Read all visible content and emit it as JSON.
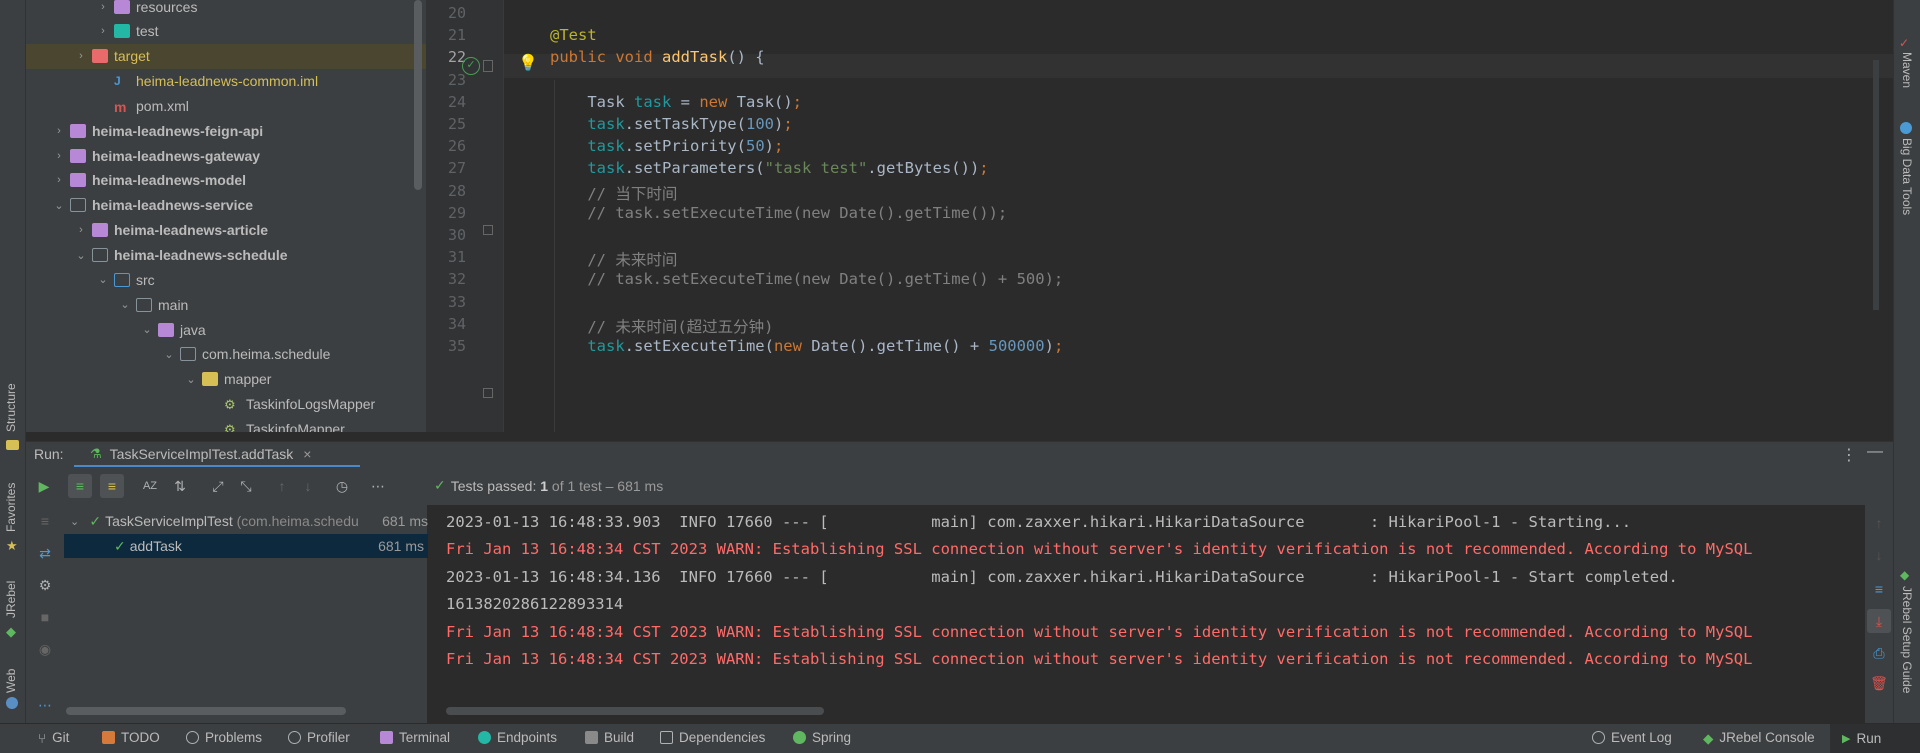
{
  "left_strip": {
    "structure": "Structure",
    "favorites": "Favorites",
    "jrebel": "JRebel",
    "web": "Web"
  },
  "right_strip": {
    "maven": "Maven",
    "bigdata": "Big Data Tools",
    "jrebel_setup": "JRebel Setup Guide"
  },
  "project_tree": [
    {
      "label": "resources",
      "indent": 3,
      "arrow": "›",
      "icon": "folder-mod"
    },
    {
      "label": "test",
      "indent": 3,
      "arrow": "›",
      "icon": "folder-teal"
    },
    {
      "label": "target",
      "indent": 2,
      "arrow": "›",
      "icon": "folder-target",
      "selected": true,
      "color": "#d6bf55"
    },
    {
      "label": "heima-leadnews-common.iml",
      "indent": 3,
      "arrow": "",
      "icon": "iml",
      "color": "#d6bf55"
    },
    {
      "label": "pom.xml",
      "indent": 3,
      "arrow": "",
      "icon": "maven"
    },
    {
      "label": "heima-leadnews-feign-api",
      "indent": 1,
      "arrow": "›",
      "icon": "folder-mod",
      "bold": true
    },
    {
      "label": "heima-leadnews-gateway",
      "indent": 1,
      "arrow": "›",
      "icon": "folder-mod",
      "bold": true
    },
    {
      "label": "heima-leadnews-model",
      "indent": 1,
      "arrow": "›",
      "icon": "folder-mod",
      "bold": true
    },
    {
      "label": "heima-leadnews-service",
      "indent": 1,
      "arrow": "⌄",
      "icon": "folder-outline",
      "bold": true
    },
    {
      "label": "heima-leadnews-article",
      "indent": 2,
      "arrow": "›",
      "icon": "folder-mod",
      "bold": true
    },
    {
      "label": "heima-leadnews-schedule",
      "indent": 2,
      "arrow": "⌄",
      "icon": "folder-outline",
      "bold": true
    },
    {
      "label": "src",
      "indent": 3,
      "arrow": "⌄",
      "icon": "folder-src"
    },
    {
      "label": "main",
      "indent": 4,
      "arrow": "⌄",
      "icon": "folder-outline"
    },
    {
      "label": "java",
      "indent": 5,
      "arrow": "⌄",
      "icon": "folder-mod"
    },
    {
      "label": "com.heima.schedule",
      "indent": 6,
      "arrow": "⌄",
      "icon": "folder-outline"
    },
    {
      "label": "mapper",
      "indent": 7,
      "arrow": "⌄",
      "icon": "folder-yellow"
    },
    {
      "label": "TaskinfoLogsMapper",
      "indent": 8,
      "arrow": "",
      "icon": "mapper"
    },
    {
      "label": "TaskinfoMapper",
      "indent": 8,
      "arrow": "",
      "icon": "mapper"
    }
  ],
  "editor": {
    "line_numbers": [
      "20",
      "21",
      "22",
      "23",
      "24",
      "25",
      "26",
      "27",
      "28",
      "29",
      "30",
      "31",
      "32",
      "33",
      "34",
      "35"
    ],
    "current_line": "22",
    "lines": [
      "",
      "<span class='ann'>@Test</span>",
      "<span class='kw'>public void </span><span class='fn'>addTask</span>() {",
      "",
      "    Task <span class='var'>task</span> = <span class='kw'>new </span>Task()<span class='kw'>;</span>",
      "    <span class='var'>task</span>.setTaskType(<span class='num'>100</span>)<span class='kw'>;</span>",
      "    <span class='var'>task</span>.setPriority(<span class='num'>50</span>)<span class='kw'>;</span>",
      "    <span class='var'>task</span>.setParameters(<span class='str'>\"task test\"</span>.getBytes())<span class='kw'>;</span>",
      "    <span class='cmt'>// 当下时间</span>",
      "    <span class='cmt'>// task.setExecuteTime(new Date().getTime());</span>",
      "",
      "    <span class='cmt'>// 未来时间</span>",
      "    <span class='cmt'>// task.setExecuteTime(new Date().getTime() + 500);</span>",
      "",
      "    <span class='cmt'>// 未来时间(超过五分钟)</span>",
      "    <span class='var'>task</span>.setExecuteTime(<span class='kw'>new </span>Date().getTime() + <span class='num'>500000</span>)<span class='kw'>;</span>"
    ]
  },
  "run": {
    "label": "Run:",
    "tab_title": "TaskServiceImplTest.addTask",
    "tests_passed_label": "Tests passed:",
    "tests_passed_count": "1",
    "tests_passed_suffix": "of 1 test – 681 ms",
    "tree": [
      {
        "name": "TaskServiceImplTest",
        "detail": "(com.heima.schedu",
        "time": "681 ms"
      },
      {
        "name": "addTask",
        "detail": "",
        "time": "681 ms"
      }
    ],
    "console": [
      {
        "text": "2023-01-13 16:48:33.903  INFO 17660 --- [           main] com.zaxxer.hikari.HikariDataSource       : HikariPool-1 - Starting...",
        "err": false
      },
      {
        "text": "Fri Jan 13 16:48:34 CST 2023 WARN: Establishing SSL connection without server's identity verification is not recommended. According to MySQL",
        "err": true
      },
      {
        "text": "2023-01-13 16:48:34.136  INFO 17660 --- [           main] com.zaxxer.hikari.HikariDataSource       : HikariPool-1 - Start completed.",
        "err": false
      },
      {
        "text": "1613820286122893314",
        "err": false
      },
      {
        "text": "Fri Jan 13 16:48:34 CST 2023 WARN: Establishing SSL connection without server's identity verification is not recommended. According to MySQL",
        "err": true
      },
      {
        "text": "Fri Jan 13 16:48:34 CST 2023 WARN: Establishing SSL connection without server's identity verification is not recommended. According to MySQL",
        "err": true
      }
    ]
  },
  "status_bar": {
    "git": "Git",
    "todo": "TODO",
    "problems": "Problems",
    "profiler": "Profiler",
    "terminal": "Terminal",
    "endpoints": "Endpoints",
    "build": "Build",
    "dependencies": "Dependencies",
    "spring": "Spring",
    "event_log": "Event Log",
    "jrebel_console": "JRebel Console",
    "run": "Run"
  },
  "colors": {
    "pass_green": "#499c54",
    "error_red": "#ff6b68",
    "selection": "#4b4630"
  }
}
